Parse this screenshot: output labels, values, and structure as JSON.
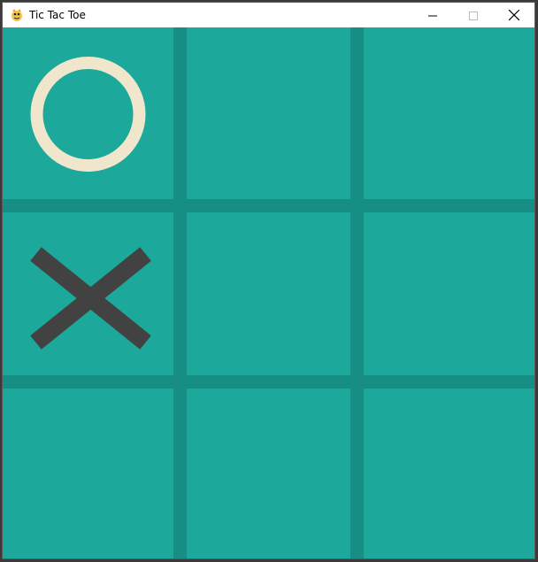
{
  "window": {
    "title": "Tic Tac Toe",
    "app_icon": "pygame-snake-icon",
    "controls": [
      "minimize-icon",
      "maximize-icon",
      "close-icon"
    ]
  },
  "colors": {
    "board": "#1ca89a",
    "grid_line": "#168e83",
    "o_mark": "#f0e6cb",
    "x_mark": "#424242"
  },
  "board": {
    "rows": 3,
    "cols": 3,
    "cells": [
      [
        "O",
        "",
        ""
      ],
      [
        "X",
        "",
        ""
      ],
      [
        "",
        "",
        ""
      ]
    ]
  }
}
